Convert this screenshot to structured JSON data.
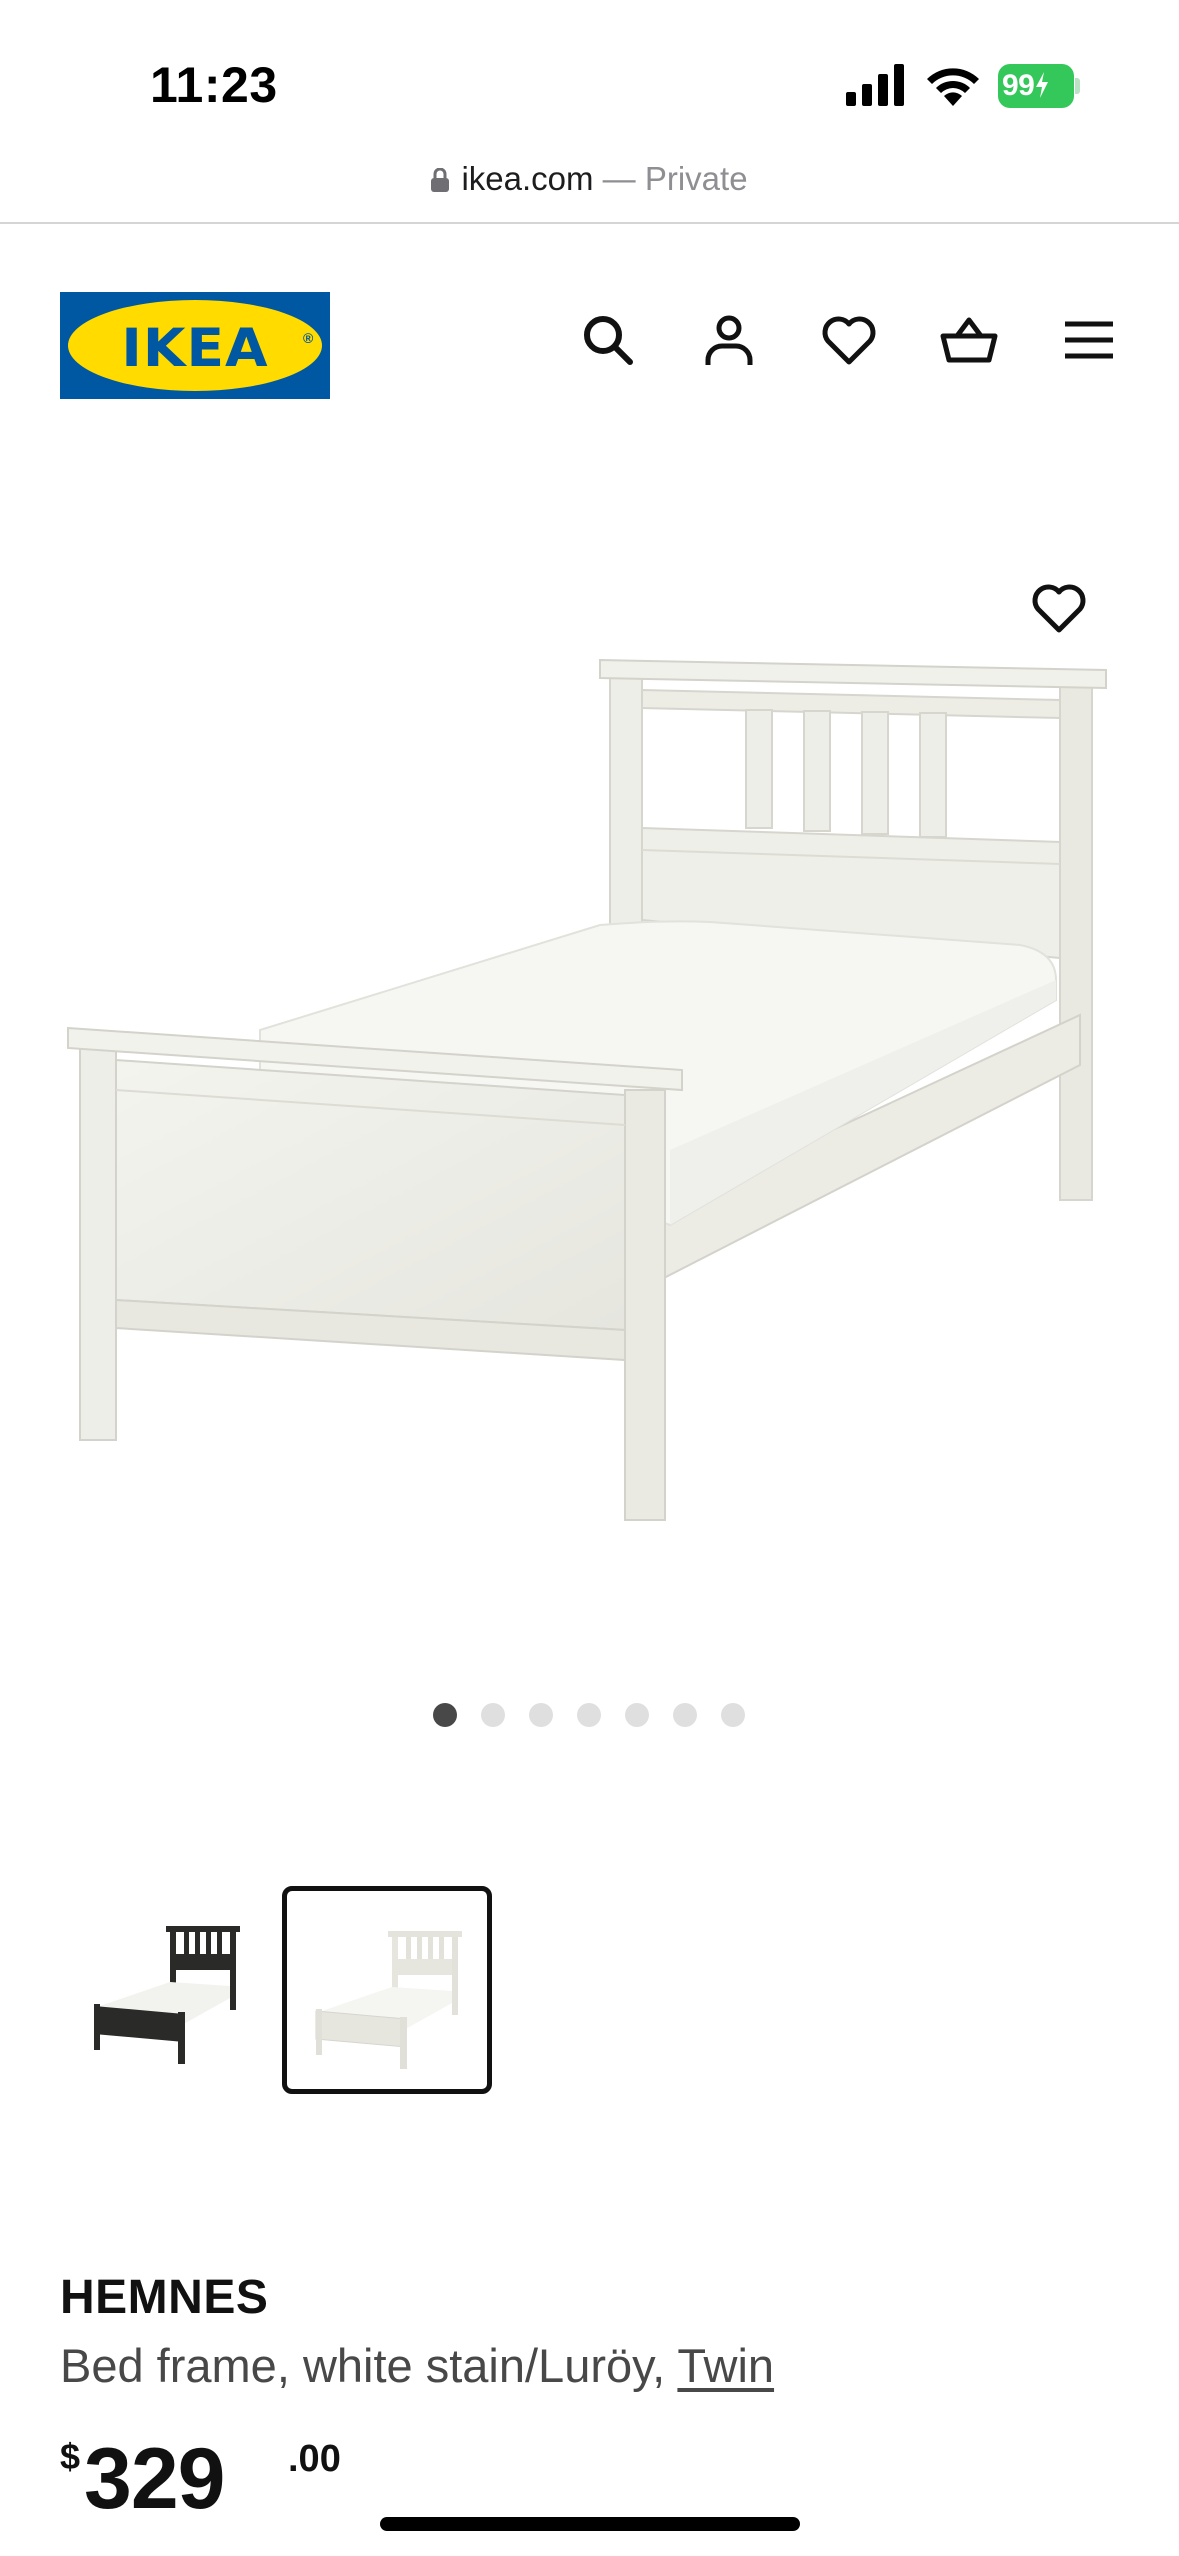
{
  "status_bar": {
    "time": "11:23",
    "battery": "99"
  },
  "url_bar": {
    "domain": "ikea.com",
    "separator": "—",
    "mode": "Private"
  },
  "header": {
    "logo_text": "IKEA",
    "icons": [
      "search-icon",
      "account-icon",
      "favourites-icon",
      "cart-icon",
      "menu-icon"
    ]
  },
  "gallery": {
    "slide_count": 7,
    "active_slide": 1,
    "thumbnails": [
      {
        "color": "black-brown",
        "selected": false
      },
      {
        "color": "white stain",
        "selected": true
      }
    ]
  },
  "product": {
    "name": "HEMNES",
    "description": "Bed frame, white stain/Luröy, ",
    "size_link": "Twin",
    "price_currency": "$",
    "price_integer": "329",
    "price_decimal": ".00"
  },
  "colors": {
    "ikea_blue": "#0058a3",
    "ikea_yellow": "#ffdb00",
    "battery_green": "#34c759",
    "text_dark": "#111111",
    "text_secondary": "#484848"
  }
}
